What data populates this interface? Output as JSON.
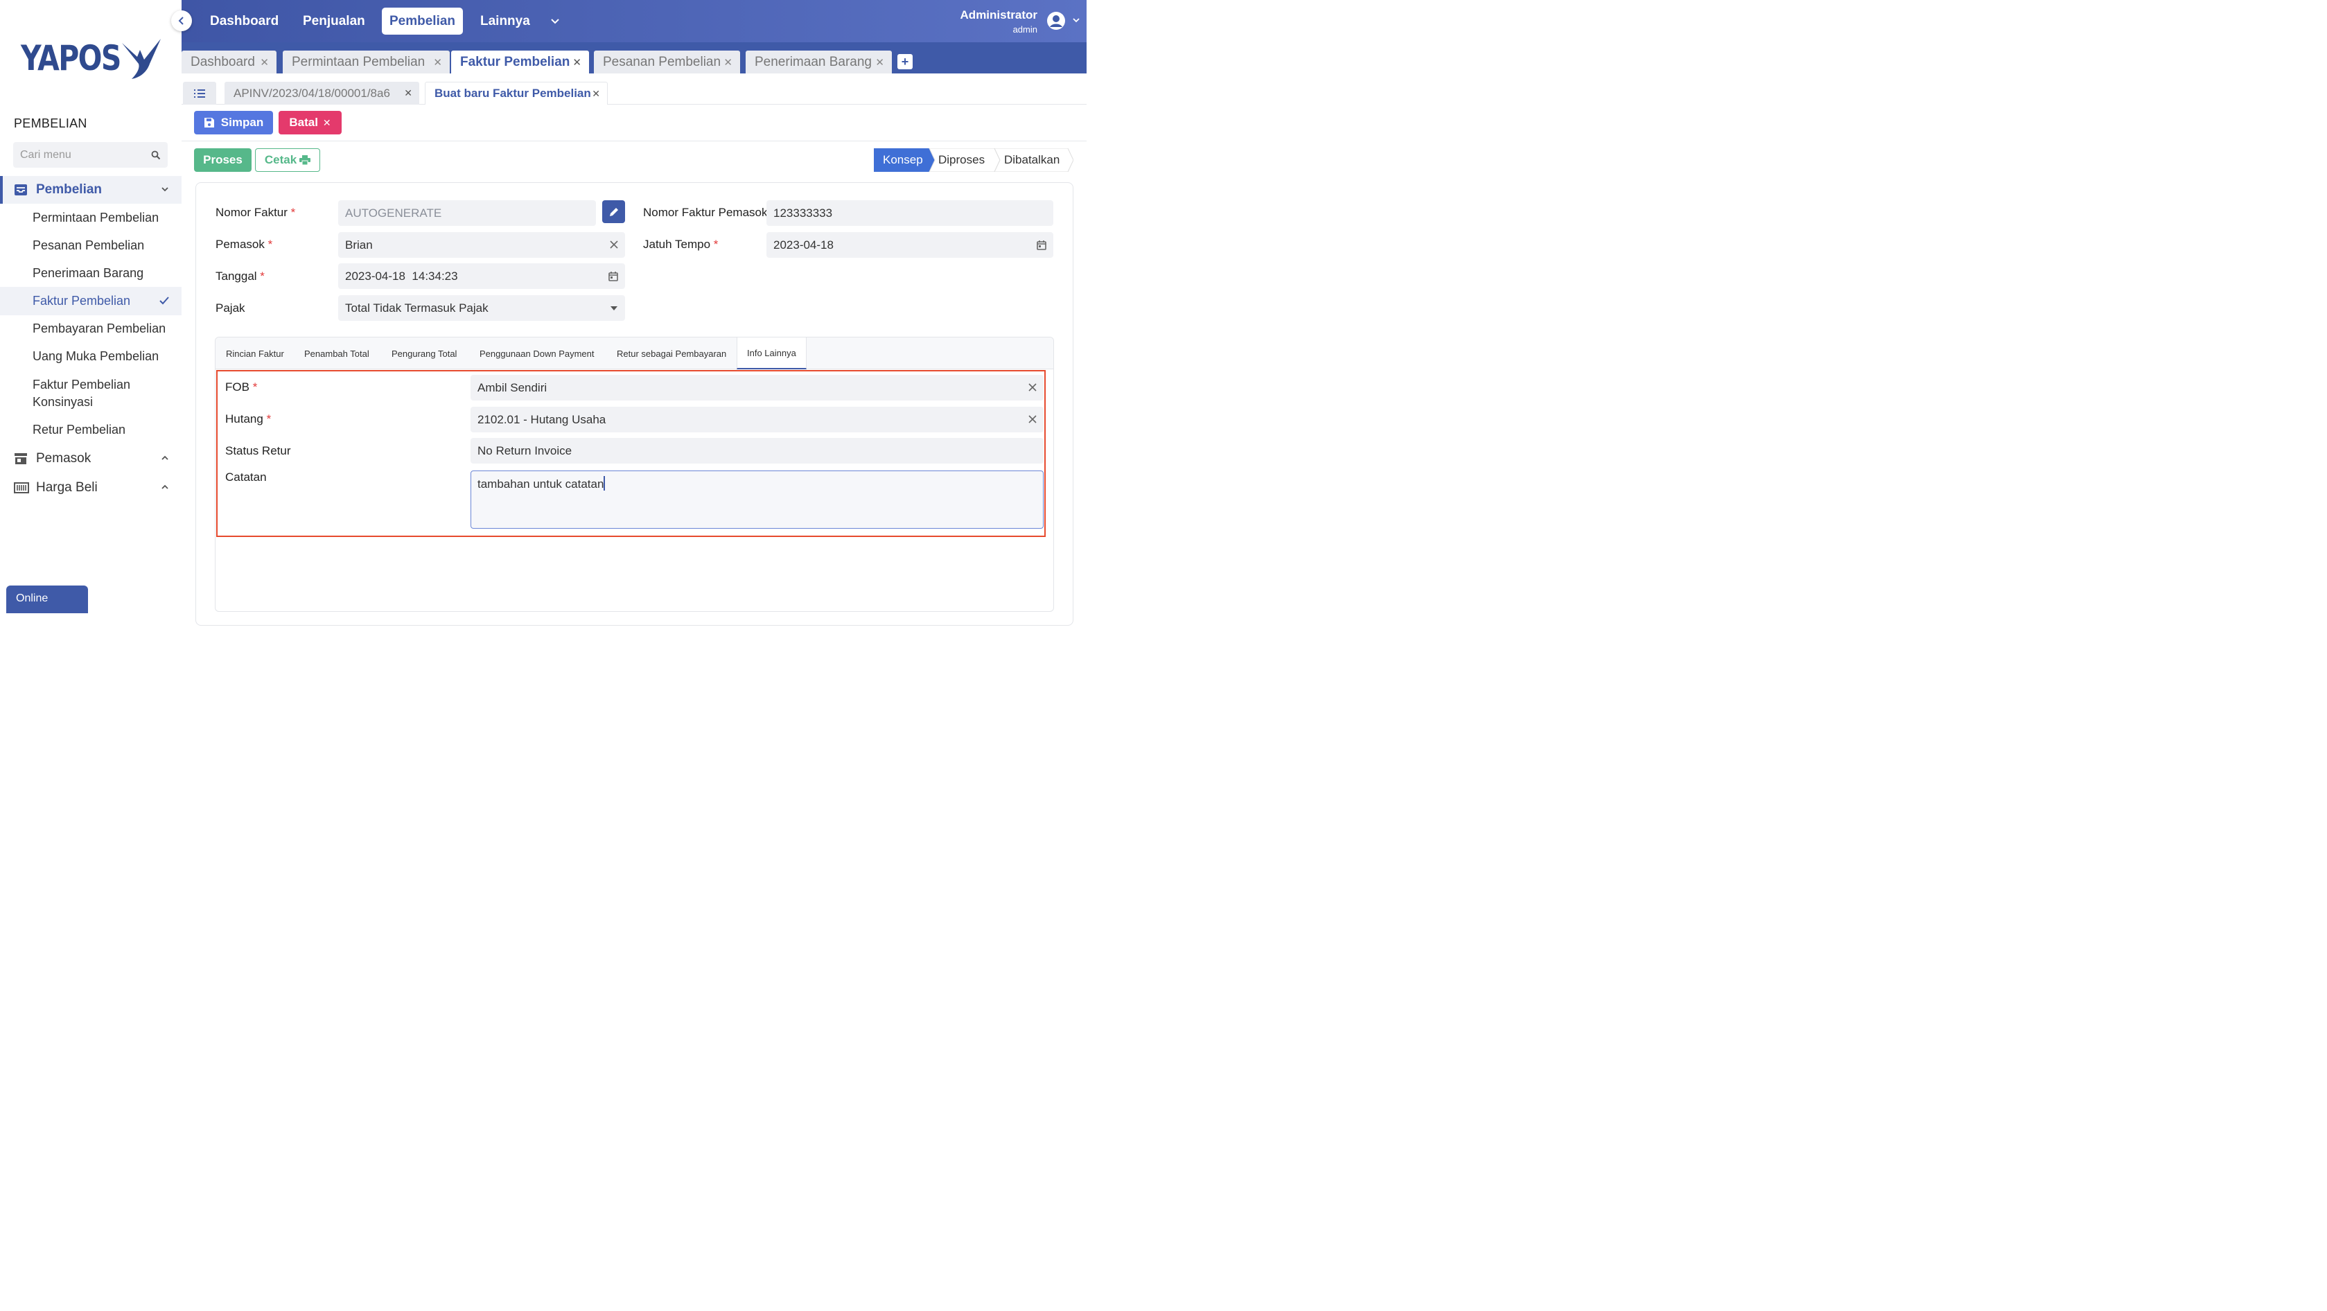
{
  "sidebar": {
    "logo_text": "YAPOS",
    "section_title": "PEMBELIAN",
    "search_placeholder": "Cari menu",
    "groups": [
      {
        "label": "Pembelian",
        "icon": "inbox-icon",
        "expanded": true
      },
      {
        "label": "Pemasok",
        "icon": "store-icon",
        "expanded": false
      },
      {
        "label": "Harga Beli",
        "icon": "barcode-icon",
        "expanded": false
      }
    ],
    "items": [
      {
        "label": "Permintaan Pembelian"
      },
      {
        "label": "Pesanan Pembelian"
      },
      {
        "label": "Penerimaan Barang"
      },
      {
        "label": "Faktur Pembelian",
        "active": true
      },
      {
        "label": "Pembayaran Pembelian"
      },
      {
        "label": "Uang Muka Pembelian"
      },
      {
        "label": "Faktur Pembelian Konsinyasi"
      },
      {
        "label": "Retur Pembelian"
      }
    ],
    "online_label": "Online"
  },
  "topnav": {
    "items": [
      {
        "label": "Dashboard"
      },
      {
        "label": "Penjualan"
      },
      {
        "label": "Pembelian",
        "active": true
      },
      {
        "label": "Lainnya"
      }
    ],
    "user_name": "Administrator",
    "user_role": "admin"
  },
  "tabs": [
    {
      "label": "Dashboard"
    },
    {
      "label": "Permintaan Pembelian"
    },
    {
      "label": "Faktur Pembelian",
      "active": true
    },
    {
      "label": "Pesanan Pembelian"
    },
    {
      "label": "Penerimaan Barang"
    }
  ],
  "subtabs": [
    {
      "label": "APINV/2023/04/18/00001/8a6"
    },
    {
      "label": "Buat baru Faktur Pembelian",
      "active": true
    }
  ],
  "actions": {
    "save_label": "Simpan",
    "cancel_label": "Batal",
    "process_label": "Proses",
    "print_label": "Cetak"
  },
  "status_steps": [
    {
      "label": "Konsep",
      "active": true
    },
    {
      "label": "Diproses"
    },
    {
      "label": "Dibatalkan"
    }
  ],
  "form": {
    "nomor_faktur_label": "Nomor Faktur",
    "nomor_faktur_value": "AUTOGENERATE",
    "pemasok_label": "Pemasok",
    "pemasok_value": "Brian",
    "tanggal_label": "Tanggal",
    "tanggal_value": "2023-04-18  14:34:23",
    "pajak_label": "Pajak",
    "pajak_value": "Total Tidak Termasuk Pajak",
    "nomor_faktur_pemasok_label": "Nomor Faktur Pemasok",
    "nomor_faktur_pemasok_value": "123333333",
    "jatuh_tempo_label": "Jatuh Tempo",
    "jatuh_tempo_value": "2023-04-18",
    "required_mark": "*"
  },
  "inner_tabs": [
    {
      "label": "Rincian Faktur"
    },
    {
      "label": "Penambah Total"
    },
    {
      "label": "Pengurang Total"
    },
    {
      "label": "Penggunaan Down Payment"
    },
    {
      "label": "Retur sebagai Pembayaran"
    },
    {
      "label": "Info Lainnya",
      "active": true
    }
  ],
  "info_lainnya": {
    "fob_label": "FOB",
    "fob_value": "Ambil Sendiri",
    "hutang_label": "Hutang",
    "hutang_value": "2102.01 - Hutang Usaha",
    "status_retur_label": "Status Retur",
    "status_retur_value": "No Return Invoice",
    "catatan_label": "Catatan",
    "catatan_value": "tambahan untuk catatan"
  },
  "colors": {
    "primary": "#3f5aa8",
    "save": "#5577e0",
    "cancel": "#e43a6c",
    "process": "#56b88a",
    "highlight": "#e64a2e"
  }
}
